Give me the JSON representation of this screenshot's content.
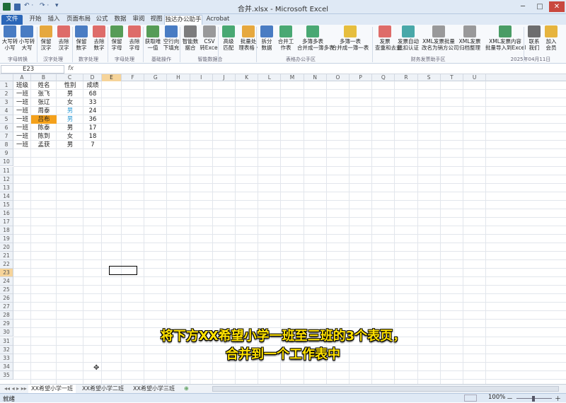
{
  "window": {
    "title": "合并.xlsx - Microsoft Excel",
    "minimize": "─",
    "restore": "□",
    "close": "✕"
  },
  "quick_access": {
    "undo": "↶ ·",
    "redo": "↷ ·",
    "customize": "▾"
  },
  "tabs": [
    "文件",
    "开始",
    "插入",
    "页面布局",
    "公式",
    "数据",
    "审阅",
    "视图",
    "独达办公助手",
    "Acrobat"
  ],
  "active_tab": "独达办公助手",
  "ribbon": {
    "buttons": [
      {
        "label": "大写转\n小写",
        "icon": "text-case-icon",
        "color": "#2a66b8"
      },
      {
        "label": "小写转\n大写",
        "icon": "text-case-icon",
        "color": "#2a66b8"
      },
      {
        "label": "保留\n汉字",
        "icon": "chinese-char-icon",
        "color": "#e39a1c"
      },
      {
        "label": "去除\n汉字",
        "icon": "eraser-icon",
        "color": "#d9534f"
      },
      {
        "label": "保留\n数字",
        "icon": "number-icon",
        "color": "#2a66b8"
      },
      {
        "label": "去除\n数字",
        "icon": "eraser-icon",
        "color": "#d9534f"
      },
      {
        "label": "保留\n字母",
        "icon": "letter-icon",
        "color": "#3a8c3a"
      },
      {
        "label": "去除\n字母",
        "icon": "eraser-icon",
        "color": "#d9534f"
      },
      {
        "label": "获取唯\n一值",
        "icon": "table-icon",
        "color": "#3a8c3a"
      },
      {
        "label": "空行向\n下填充",
        "icon": "fill-down-icon",
        "color": "#2a66b8"
      },
      {
        "label": "智能数\n据合",
        "icon": "database-icon",
        "color": "#666666"
      },
      {
        "label": "CSV\n转Excel",
        "icon": "csv-icon",
        "color": "#888888"
      },
      {
        "label": "高级\n匹配",
        "icon": "match-icon",
        "color": "#2a9a5a"
      },
      {
        "label": "批量处\n理表格 ·",
        "icon": "grid-icon",
        "color": "#e39a1c"
      },
      {
        "label": "拆分\n数据",
        "icon": "split-icon",
        "color": "#2a66b8"
      },
      {
        "label": "合并工\n作表",
        "icon": "merge-icon",
        "color": "#2a9a5a"
      },
      {
        "label": "多簿多表\n合并成一簿多表",
        "icon": "workbook-icon",
        "color": "#2a9a5a"
      },
      {
        "label": "多簿一表\n合并成一簿一表",
        "icon": "folder-icon",
        "color": "#e3b41c"
      },
      {
        "label": "发票\n查重和去重",
        "icon": "search-icon",
        "color": "#d9534f"
      },
      {
        "label": "发票自动\n抵扣认证",
        "icon": "invoice-icon",
        "color": "#2a9a9a"
      },
      {
        "label": "XML发票批量\n改名为销方公司",
        "icon": "xml-icon",
        "color": "#888888"
      },
      {
        "label": "XML发票\n归档整理",
        "icon": "xml-icon",
        "color": "#888888"
      },
      {
        "label": "XML发票内容\n批量导入到Excel",
        "icon": "excel-icon",
        "color": "#2a8c4a"
      },
      {
        "label": "联系\n我们",
        "icon": "contact-icon",
        "color": "#555555"
      },
      {
        "label": "加入\n会员",
        "icon": "crown-icon",
        "color": "#e3a81c"
      }
    ],
    "groups": [
      "字母转换",
      "汉字处理",
      "数字处理",
      "字母处理",
      "基础操作",
      "智能数据合",
      "表格办公手区",
      "财务发票助手区",
      "2025年04月11日"
    ]
  },
  "formula_bar": {
    "name_box": "E23",
    "fx": "fx"
  },
  "columns": [
    "A",
    "B",
    "C",
    "D",
    "E",
    "F",
    "G",
    "H",
    "I",
    "J",
    "K",
    "L",
    "M",
    "N",
    "O",
    "P",
    "Q",
    "R",
    "S",
    "T",
    "U"
  ],
  "selected_column": "E",
  "selected_row": 23,
  "row_count": 35,
  "table": {
    "headers": [
      "班级",
      "姓名",
      "性别",
      "成绩"
    ],
    "rows": [
      [
        "一班",
        "张飞",
        "男",
        "68"
      ],
      [
        "一班",
        "张辽",
        "女",
        "33"
      ],
      [
        "一班",
        "周泰",
        "男",
        "24"
      ],
      [
        "一班",
        "吕布",
        "男",
        "36"
      ],
      [
        "一班",
        "陈泰",
        "男",
        "17"
      ],
      [
        "一班",
        "陈到",
        "女",
        "18"
      ],
      [
        "一班",
        "孟获",
        "男",
        "7"
      ]
    ],
    "highlight_color": "#f4a11c",
    "blue_text_color": "#2e9bd6"
  },
  "subtitle": {
    "line1": "将下方XX希望小学一班至三班的3个表页，",
    "line2": "合并到一个工作表中"
  },
  "sheets": [
    "XX希望小学一班",
    "XX希望小学二班",
    "XX希望小学三班"
  ],
  "active_sheet": "XX希望小学一班",
  "status": {
    "ready": "就绪",
    "zoom": "100%",
    "zoom_out": "－",
    "zoom_in": "＋"
  }
}
